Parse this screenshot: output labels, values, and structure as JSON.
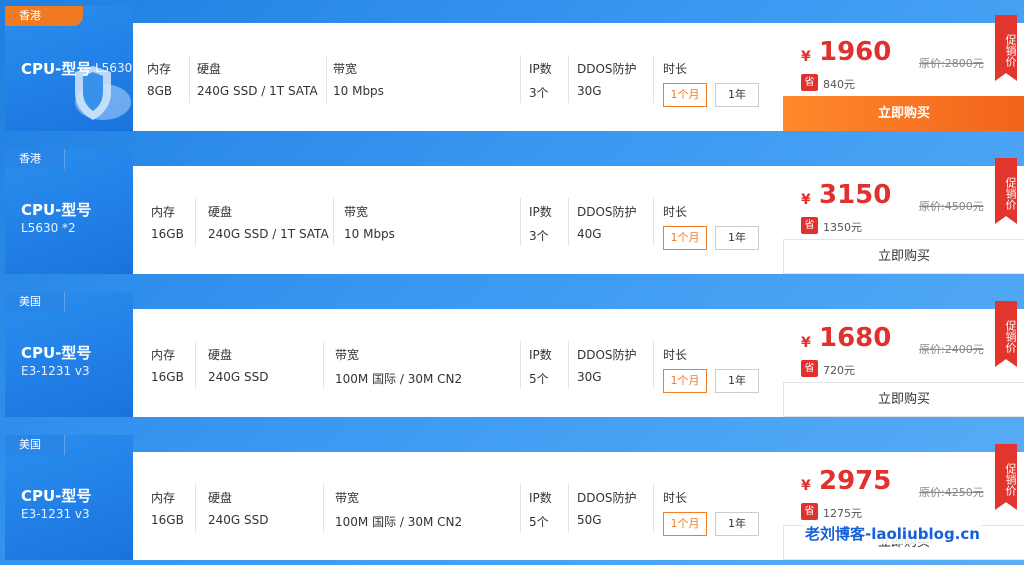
{
  "labels": {
    "memory": "内存",
    "disk": "硬盘",
    "bandwidth": "带宽",
    "ip": "IP数",
    "ddos": "DDOS防护",
    "duration": "时长",
    "dur_month": "1个月",
    "dur_year": "1年",
    "currency": "¥",
    "save": "省",
    "promo": "促销价",
    "buy": "立即购买"
  },
  "plans": [
    {
      "region": "香港",
      "cpu_title": "CPU-型号",
      "cpu_model": "L5630",
      "memory": "8GB",
      "disk": "240G SSD / 1T SATA",
      "bandwidth": "10 Mbps",
      "ip": "3个",
      "ddos": "30G",
      "price": "1960",
      "original": "原价:2800元",
      "saving": "840元"
    },
    {
      "region": "香港",
      "cpu_title": "CPU-型号",
      "cpu_model": "L5630 *2",
      "memory": "16GB",
      "disk": "240G SSD / 1T SATA",
      "bandwidth": "10 Mbps",
      "ip": "3个",
      "ddos": "40G",
      "price": "3150",
      "original": "原价:4500元",
      "saving": "1350元"
    },
    {
      "region": "美国",
      "cpu_title": "CPU-型号",
      "cpu_model": "E3-1231 v3",
      "memory": "16GB",
      "disk": "240G SSD",
      "bandwidth": "100M 国际 / 30M CN2",
      "ip": "5个",
      "ddos": "30G",
      "price": "1680",
      "original": "原价:2400元",
      "saving": "720元"
    },
    {
      "region": "美国",
      "cpu_title": "CPU-型号",
      "cpu_model": "E3-1231 v3",
      "memory": "16GB",
      "disk": "240G SSD",
      "bandwidth": "100M 国际 / 30M CN2",
      "ip": "5个",
      "ddos": "50G",
      "price": "2975",
      "original": "原价:4250元",
      "saving": "1275元"
    }
  ],
  "watermark": "老刘博客-laoliublog.cn",
  "colors": {
    "accent_orange": "#f27c24",
    "price_red": "#e0312f",
    "brand_blue": "#1a73dd"
  }
}
